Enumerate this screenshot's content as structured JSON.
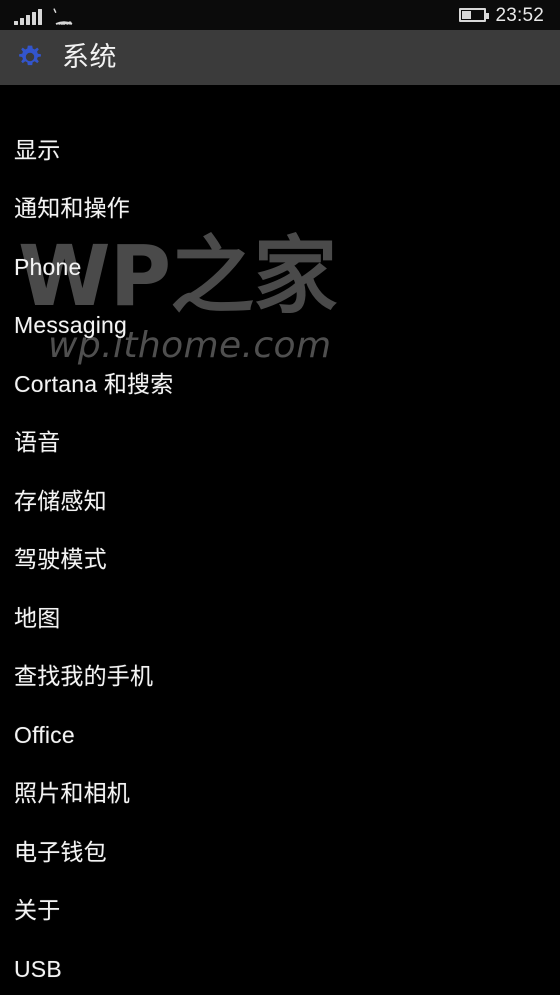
{
  "status_bar": {
    "signal_icon": "signal-bars-icon",
    "signal_bars": 5,
    "wifi_icon": "wifi-icon",
    "battery_icon": "battery-icon",
    "battery_level_percent": 38,
    "time": "23:52"
  },
  "header": {
    "icon": "gear-icon",
    "title": "系统",
    "background_color": "#3b3b3b",
    "icon_color": "#3355cc"
  },
  "settings": {
    "items": [
      {
        "label": "显示"
      },
      {
        "label": "通知和操作"
      },
      {
        "label": "Phone"
      },
      {
        "label": "Messaging"
      },
      {
        "label": "Cortana 和搜索"
      },
      {
        "label": "语音"
      },
      {
        "label": "存储感知"
      },
      {
        "label": "驾驶模式"
      },
      {
        "label": "地图"
      },
      {
        "label": "查找我的手机"
      },
      {
        "label": "Office"
      },
      {
        "label": "照片和相机"
      },
      {
        "label": "电子钱包"
      },
      {
        "label": "关于"
      },
      {
        "label": "USB"
      }
    ]
  },
  "watermark": {
    "main": "WP之家",
    "url": "wp.ithome.com",
    "color": "#4a4a4a"
  }
}
